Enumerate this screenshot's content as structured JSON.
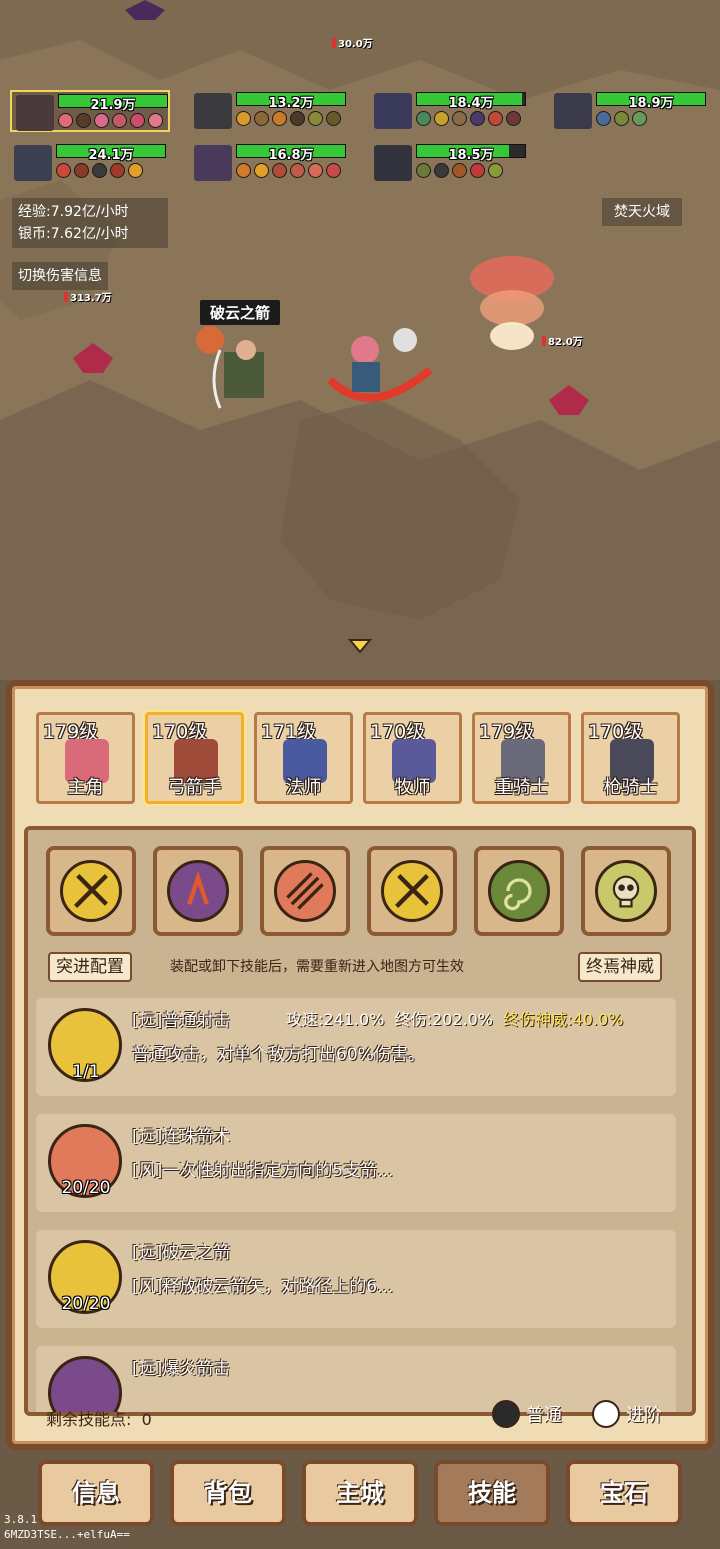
{
  "party": [
    {
      "hp": "21.9万",
      "hp_pct": 1.0,
      "selected": true
    },
    {
      "hp": "13.2万",
      "hp_pct": 1.0
    },
    {
      "hp": "18.4万",
      "hp_pct": 0.97
    },
    {
      "hp": "18.9万",
      "hp_pct": 1.0
    },
    {
      "hp": "24.1万",
      "hp_pct": 1.0
    },
    {
      "hp": "16.8万",
      "hp_pct": 1.0
    },
    {
      "hp": "18.5万",
      "hp_pct": 0.85
    }
  ],
  "stats": {
    "exp": "经验:7.92亿/小时",
    "silver": "银币:7.62亿/小时",
    "toggle_damage": "切换伤害信息",
    "zone": "焚天火域"
  },
  "damage_labels": {
    "top": "30.0万",
    "left": "313.7万",
    "right": "82.0万"
  },
  "battle": {
    "callout": "破云之箭"
  },
  "heroes": [
    {
      "level": "179级",
      "name": "主角"
    },
    {
      "level": "170级",
      "name": "弓箭手",
      "selected": true
    },
    {
      "level": "171级",
      "name": "法师"
    },
    {
      "level": "170级",
      "name": "牧师"
    },
    {
      "level": "179级",
      "name": "重骑士"
    },
    {
      "level": "170级",
      "name": "枪骑士"
    }
  ],
  "skills_panel": {
    "rush_config": "突进配置",
    "notice": "装配或卸下技能后，需要重新进入地图方可生效",
    "ultimate": "终焉神威",
    "list": [
      {
        "name": "[远]普通射击",
        "count": "1/1",
        "desc": "普通攻击，对单个敌方打出60%伤害。",
        "attack_speed": "攻速:241.0%",
        "final_damage": "终伤:202.0%",
        "ult_bonus": "终伤神威:40.0%"
      },
      {
        "name": "[远]连珠箭术",
        "count": "20/20",
        "desc": "[风]一次性射出指定方向的5支箭..."
      },
      {
        "name": "[远]破云之箭",
        "count": "20/20",
        "desc": "[风]释放破云箭矢，对路径上的6..."
      },
      {
        "name": "[远]爆炎箭击",
        "count": "",
        "desc": ""
      }
    ],
    "remaining_points_label": "剩余技能点:",
    "remaining_points": "0",
    "mode_normal": "普通",
    "mode_advanced": "进阶"
  },
  "tabs": [
    "信息",
    "背包",
    "主城",
    "技能",
    "宝石"
  ],
  "version": {
    "line1": "3.8.1",
    "line2": "6MZD3TSE...+elfuA=="
  },
  "colors": {
    "hp_green": "#37c837",
    "panel_bg": "#f0dcb4",
    "frame_brown": "#7a4a2c",
    "gold_text": "#ffe45c"
  }
}
